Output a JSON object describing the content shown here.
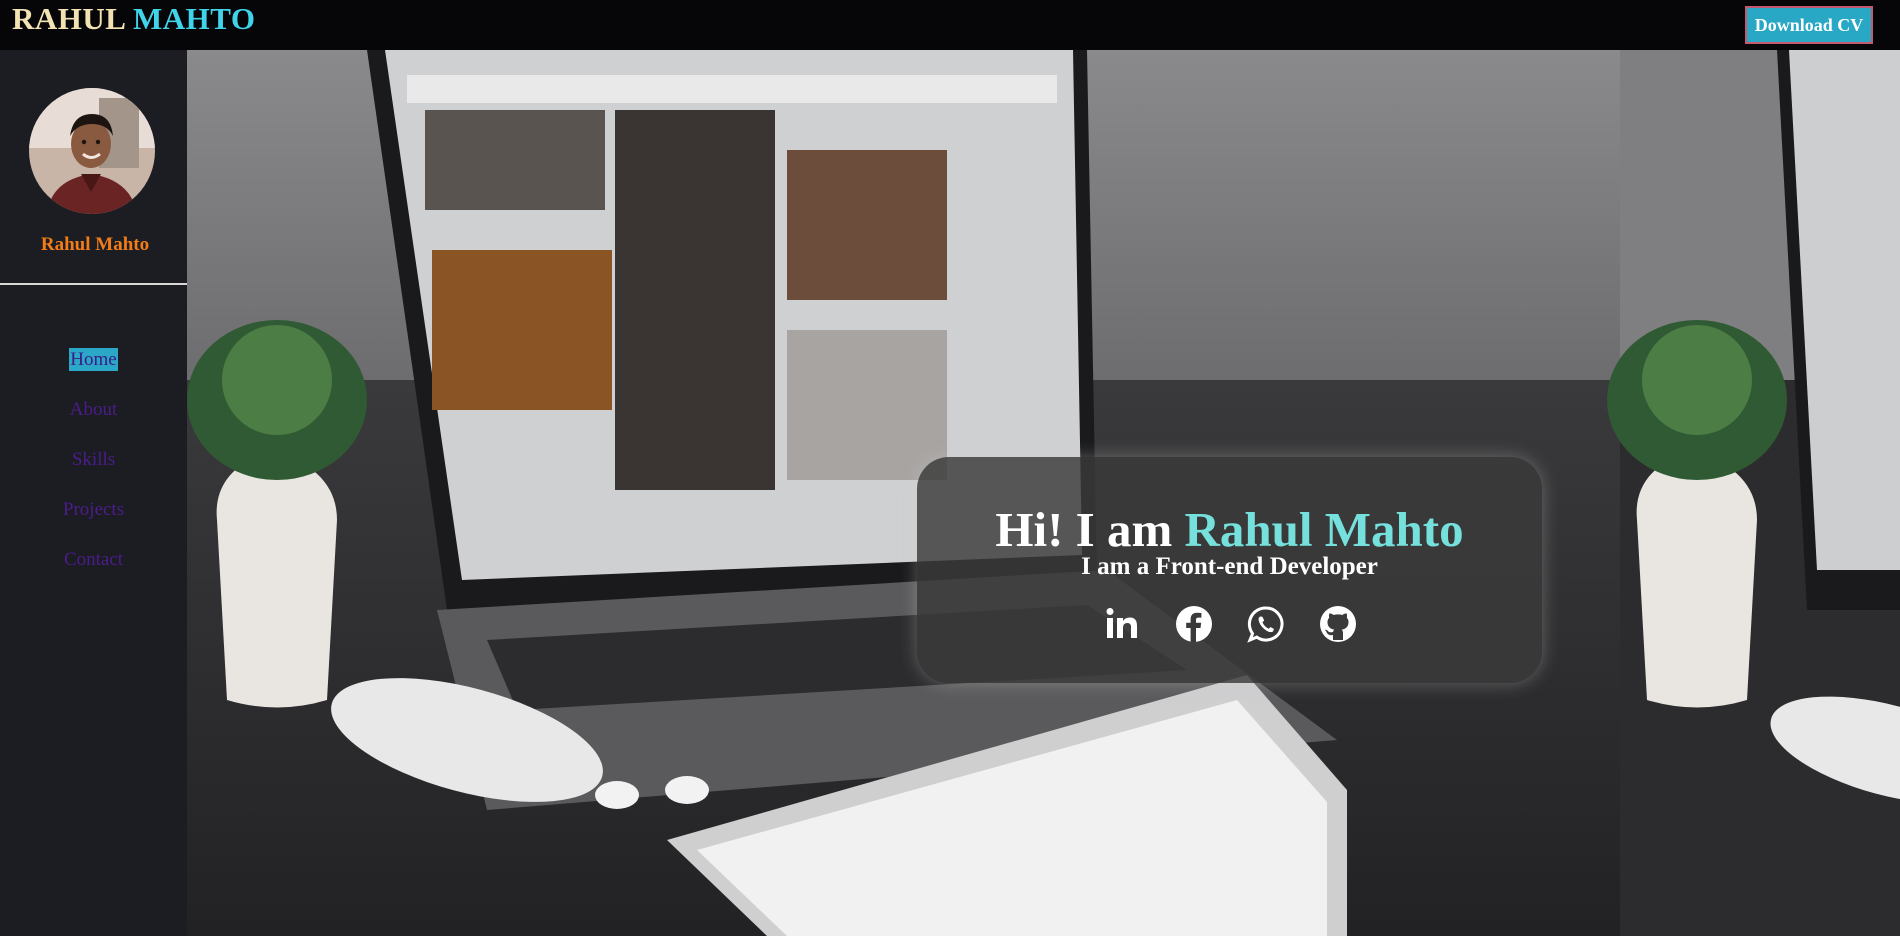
{
  "header": {
    "logo_first": "RAHUL",
    "logo_last": "MAHTO",
    "download_label": "Download CV"
  },
  "sidebar": {
    "profile_name": "Rahul Mahto",
    "nav": [
      {
        "label": "Home",
        "active": true
      },
      {
        "label": "About"
      },
      {
        "label": "Skills"
      },
      {
        "label": "Projects"
      },
      {
        "label": "Contact"
      }
    ]
  },
  "hero": {
    "greeting": "Hi! I am",
    "name": "Rahul Mahto",
    "subtitle": "I am a Front-end Developer",
    "socials": [
      "linkedin-icon",
      "facebook-icon",
      "whatsapp-icon",
      "github-icon"
    ]
  },
  "colors": {
    "logo_first": "#f4e3b2",
    "logo_accent": "#3fd4ea",
    "name_accent": "#76e0dd",
    "profile_name": "#f27d18",
    "nav_link": "#4b1c8b",
    "active_highlight": "#2ba8c8",
    "button_bg": "#29a8c6"
  }
}
